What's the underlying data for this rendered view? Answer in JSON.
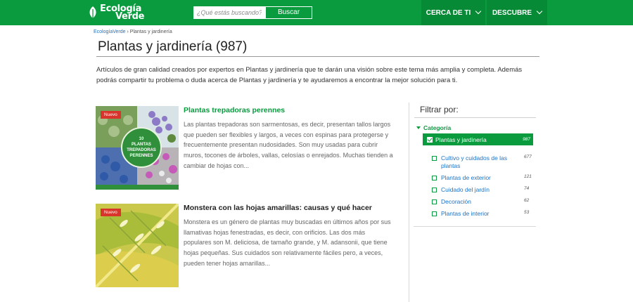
{
  "header": {
    "brand": [
      "Ecología",
      "Verde"
    ],
    "search_placeholder": "¿Qué estás buscando?",
    "search_button": "Buscar",
    "nav": [
      {
        "label": "CERCA DE TI"
      },
      {
        "label": "DESCUBRE"
      }
    ]
  },
  "breadcrumb": {
    "home": "EcologíaVerde",
    "separator": "›",
    "current": "Plantas y jardinería"
  },
  "page": {
    "title": "Plantas y jardinería (987)",
    "intro": "Artículos de gran calidad creados por expertos en Plantas y jardinería que te darán una visión sobre este tema más amplia y completa. Además podrás compartir tu problema o duda acerca de Plantas y jardinería y te ayudaremos a encontrar la mejor solución para ti."
  },
  "articles": [
    {
      "badge": "Nuevo",
      "title": "Plantas trepadoras perennes",
      "description": "Las plantas trepadoras son sarmentosas, es decir, presentan tallos largos que pueden ser flexibles y largos, a veces con espinas para protegerse y frecuentemente presentan nudosidades. Son muy usadas para cubrir muros, tocones de árboles, vallas, celosías o enrejados. Muchas tienden a cambiar de hojas con...",
      "thumb_text": [
        "10",
        "PLANTAS",
        "TREPADORAS",
        "PERENNES"
      ]
    },
    {
      "badge": "Nuevo",
      "title": "Monstera con las hojas amarillas: causas y qué hacer",
      "description": "Monstera es un género de plantas muy buscadas en últimos años por sus llamativas hojas fenestradas, es decir, con orificios. Las dos más populares son M. deliciosa, de tamaño grande, y M. adansonii, que tiene hojas pequeñas. Sus cuidados son relativamente fáciles pero, a veces, pueden tener hojas amarillas..."
    }
  ],
  "filter": {
    "title": "Filtrar por:",
    "category_label": "Categoría",
    "active": {
      "label": "Plantas y jardinería",
      "count": "987"
    },
    "items": [
      {
        "label": "Cultivo y cuidados de las plantas",
        "count": "677"
      },
      {
        "label": "Plantas de exterior",
        "count": "121"
      },
      {
        "label": "Cuidado del jardín",
        "count": "74"
      },
      {
        "label": "Decoración",
        "count": "62"
      },
      {
        "label": "Plantas de interior",
        "count": "53"
      }
    ]
  },
  "colors": {
    "brand_green": "#0a9b3f",
    "nav_green": "#078a36",
    "badge_red": "#d9342b",
    "link_blue": "#1a73c8"
  }
}
